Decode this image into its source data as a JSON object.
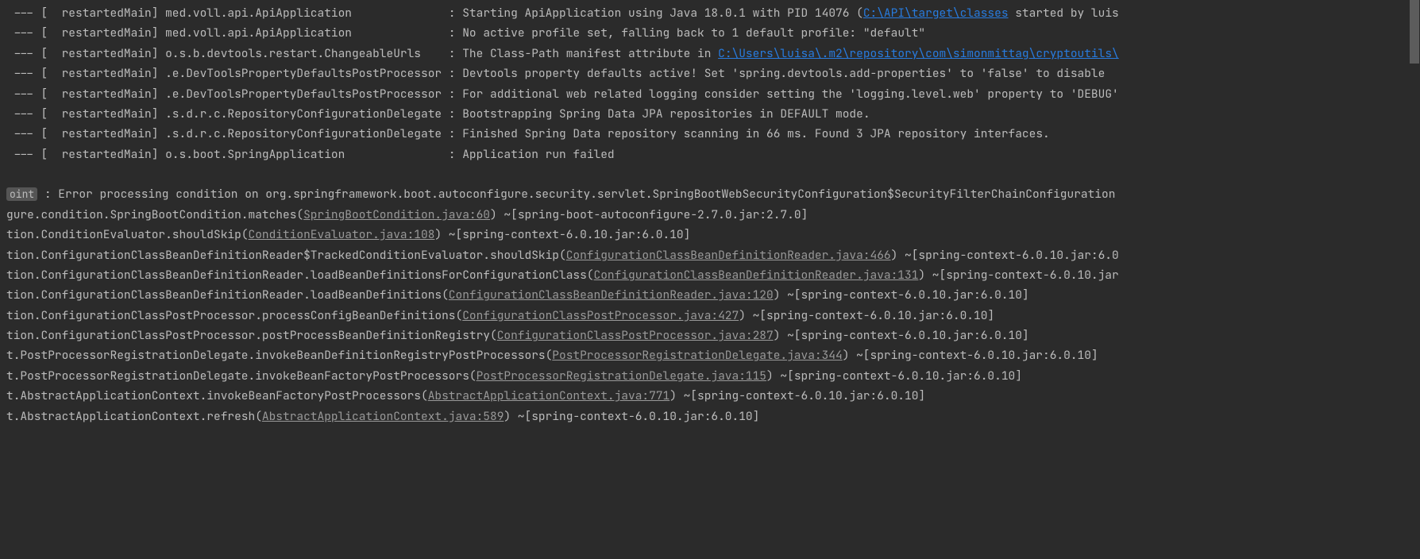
{
  "logs": [
    {
      "prefix": " --- [  restartedMain] ",
      "logger": "med.voll.api.ApiApplication             ",
      "sep": " : ",
      "msgPre": "Starting ApiApplication using Java 18.0.1 with PID 14076 (",
      "link": "C:\\API\\target\\classes",
      "msgPost": " started by luis"
    },
    {
      "prefix": " --- [  restartedMain] ",
      "logger": "med.voll.api.ApiApplication             ",
      "sep": " : ",
      "msgPre": "No active profile set, falling back to 1 default profile: \"default\"",
      "link": "",
      "msgPost": ""
    },
    {
      "prefix": " --- [  restartedMain] ",
      "logger": "o.s.b.devtools.restart.ChangeableUrls   ",
      "sep": " : ",
      "msgPre": "The Class-Path manifest attribute in ",
      "link": "C:\\Users\\luisa\\.m2\\repository\\com\\simonmittag\\cryptoutils\\",
      "msgPost": ""
    },
    {
      "prefix": " --- [  restartedMain] ",
      "logger": ".e.DevToolsPropertyDefaultsPostProcessor",
      "sep": " : ",
      "msgPre": "Devtools property defaults active! Set 'spring.devtools.add-properties' to 'false' to disable ",
      "link": "",
      "msgPost": ""
    },
    {
      "prefix": " --- [  restartedMain] ",
      "logger": ".e.DevToolsPropertyDefaultsPostProcessor",
      "sep": " : ",
      "msgPre": "For additional web related logging consider setting the 'logging.level.web' property to 'DEBUG'",
      "link": "",
      "msgPost": ""
    },
    {
      "prefix": " --- [  restartedMain] ",
      "logger": ".s.d.r.c.RepositoryConfigurationDelegate",
      "sep": " : ",
      "msgPre": "Bootstrapping Spring Data JPA repositories in DEFAULT mode.",
      "link": "",
      "msgPost": ""
    },
    {
      "prefix": " --- [  restartedMain] ",
      "logger": ".s.d.r.c.RepositoryConfigurationDelegate",
      "sep": " : ",
      "msgPre": "Finished Spring Data repository scanning in 66 ms. Found 3 JPA repository interfaces.",
      "link": "",
      "msgPost": ""
    },
    {
      "prefix": " --- [  restartedMain] ",
      "logger": "o.s.boot.SpringApplication              ",
      "sep": " : ",
      "msgPre": "Application run failed",
      "link": "",
      "msgPost": ""
    }
  ],
  "errorBadge": "oint",
  "errorLine": " : Error processing condition on org.springframework.boot.autoconfigure.security.servlet.SpringBootWebSecurityConfiguration$SecurityFilterChainConfiguration",
  "stack": [
    {
      "pre": "gure.condition.SpringBootCondition.matches(",
      "file": "SpringBootCondition.java:60",
      "post": ") ~[spring-boot-autoconfigure-2.7.0.jar:2.7.0]"
    },
    {
      "pre": "tion.ConditionEvaluator.shouldSkip(",
      "file": "ConditionEvaluator.java:108",
      "post": ") ~[spring-context-6.0.10.jar:6.0.10]"
    },
    {
      "pre": "tion.ConfigurationClassBeanDefinitionReader$TrackedConditionEvaluator.shouldSkip(",
      "file": "ConfigurationClassBeanDefinitionReader.java:466",
      "post": ") ~[spring-context-6.0.10.jar:6.0"
    },
    {
      "pre": "tion.ConfigurationClassBeanDefinitionReader.loadBeanDefinitionsForConfigurationClass(",
      "file": "ConfigurationClassBeanDefinitionReader.java:131",
      "post": ") ~[spring-context-6.0.10.jar"
    },
    {
      "pre": "tion.ConfigurationClassBeanDefinitionReader.loadBeanDefinitions(",
      "file": "ConfigurationClassBeanDefinitionReader.java:120",
      "post": ") ~[spring-context-6.0.10.jar:6.0.10]"
    },
    {
      "pre": "tion.ConfigurationClassPostProcessor.processConfigBeanDefinitions(",
      "file": "ConfigurationClassPostProcessor.java:427",
      "post": ") ~[spring-context-6.0.10.jar:6.0.10]"
    },
    {
      "pre": "tion.ConfigurationClassPostProcessor.postProcessBeanDefinitionRegistry(",
      "file": "ConfigurationClassPostProcessor.java:287",
      "post": ") ~[spring-context-6.0.10.jar:6.0.10]"
    },
    {
      "pre": "t.PostProcessorRegistrationDelegate.invokeBeanDefinitionRegistryPostProcessors(",
      "file": "PostProcessorRegistrationDelegate.java:344",
      "post": ") ~[spring-context-6.0.10.jar:6.0.10]"
    },
    {
      "pre": "t.PostProcessorRegistrationDelegate.invokeBeanFactoryPostProcessors(",
      "file": "PostProcessorRegistrationDelegate.java:115",
      "post": ") ~[spring-context-6.0.10.jar:6.0.10]"
    },
    {
      "pre": "t.AbstractApplicationContext.invokeBeanFactoryPostProcessors(",
      "file": "AbstractApplicationContext.java:771",
      "post": ") ~[spring-context-6.0.10.jar:6.0.10]"
    },
    {
      "pre": "t.AbstractApplicationContext.refresh(",
      "file": "AbstractApplicationContext.java:589",
      "post": ") ~[spring-context-6.0.10.jar:6.0.10]"
    }
  ]
}
